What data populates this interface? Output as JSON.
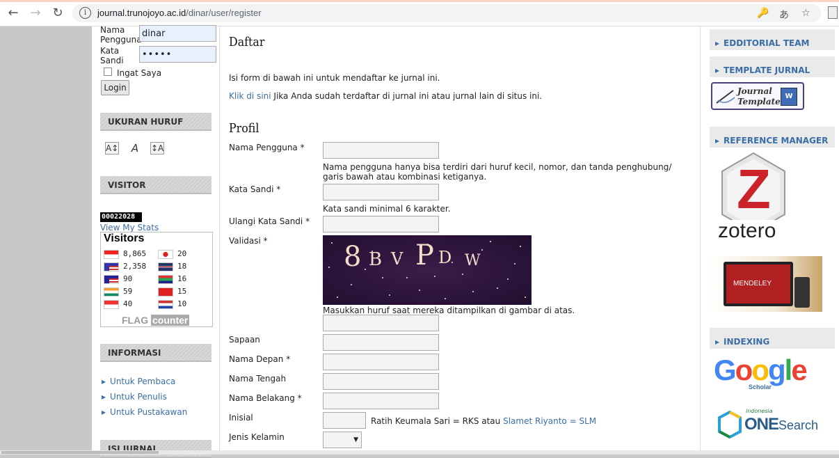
{
  "browser": {
    "url_host": "journal.trunojoyo.ac.id",
    "url_path": "/dinar/user/register"
  },
  "left_sidebar": {
    "username_label": "Nama Pengguna",
    "username_value": "dinar",
    "password_label": "Kata Sandi",
    "password_value": "•••••",
    "remember_label": "Ingat Saya",
    "login_button": "Login",
    "font_size_title": "UKURAN HURUF",
    "visitor_title": "VISITOR",
    "counter_value": "00022028",
    "view_stats_link": "View My Stats",
    "flag_counter": {
      "title": "Visitors",
      "left": [
        {
          "count": "8,865",
          "country": "Indonesia"
        },
        {
          "count": "2,358",
          "country": "United States"
        },
        {
          "count": "90",
          "country": "Malaysia"
        },
        {
          "count": "59",
          "country": "India"
        },
        {
          "count": "40",
          "country": "Singapore"
        }
      ],
      "right": [
        {
          "count": "20",
          "country": "Japan"
        },
        {
          "count": "18",
          "country": "United Kingdom"
        },
        {
          "count": "16",
          "country": "South Africa"
        },
        {
          "count": "15",
          "country": "China"
        },
        {
          "count": "10",
          "country": "Netherlands"
        }
      ],
      "brand_left": "FLAG",
      "brand_right": "counter"
    },
    "info_title": "INFORMASI",
    "info_items": [
      "Untuk Pembaca",
      "Untuk Penulis",
      "Untuk Pustakawan"
    ],
    "journal_title": "ISI JURNAL"
  },
  "main": {
    "title": "Daftar",
    "intro": "Isi form di bawah ini untuk mendaftar ke jurnal ini.",
    "click_link": "Klik di sini",
    "click_rest": " Jika Anda sudah terdaftar di jurnal ini atau jurnal lain di situs ini.",
    "profile_heading": "Profil",
    "fields": {
      "username": "Nama Pengguna *",
      "username_help": "Nama pengguna hanya bisa terdiri dari huruf kecil, nomor, dan tanda penghubung/ garis bawah atau kombinasi ketiganya.",
      "password": "Kata Sandi *",
      "password_help": "Kata sandi minimal 6 karakter.",
      "password_repeat": "Ulangi Kata Sandi *",
      "validation": "Validasi *",
      "captcha_help": "Masukkan huruf saat mereka ditampilkan di gambar di atas.",
      "salutation": "Sapaan",
      "first_name": "Nama Depan *",
      "middle_name": "Nama Tengah",
      "last_name": "Nama Belakang *",
      "initials": "Inisial",
      "initials_example": "Ratih Keumala Sari = RKS atau ",
      "initials_example_link": "Slamet Riyanto = SLM",
      "gender": "Jenis Kelamin"
    },
    "captcha_text": [
      "8",
      "B",
      "V",
      "P",
      "D",
      "W"
    ]
  },
  "right_sidebar": {
    "blocks": [
      "EDDITORIAL TEAM",
      "TEMPLATE JURNAL",
      "REFERENCE MANAGER",
      "INDEXING"
    ],
    "template_button": "Journal Template",
    "template_icon": "W",
    "zotero_text": "zotero",
    "zotero_letter": "Z",
    "mendeley_text": "MENDELEY",
    "google_text": [
      "G",
      "o",
      "o",
      "g",
      "l",
      "e"
    ],
    "google_sub": "Scholar",
    "onesearch_top": "indonesia",
    "onesearch_one": "ONE",
    "onesearch_search": "Search"
  },
  "colors": {
    "link": "#3a6ea5",
    "google": [
      "#4285f4",
      "#ea4335",
      "#fbbc05",
      "#4285f4",
      "#34a853",
      "#ea4335"
    ]
  }
}
